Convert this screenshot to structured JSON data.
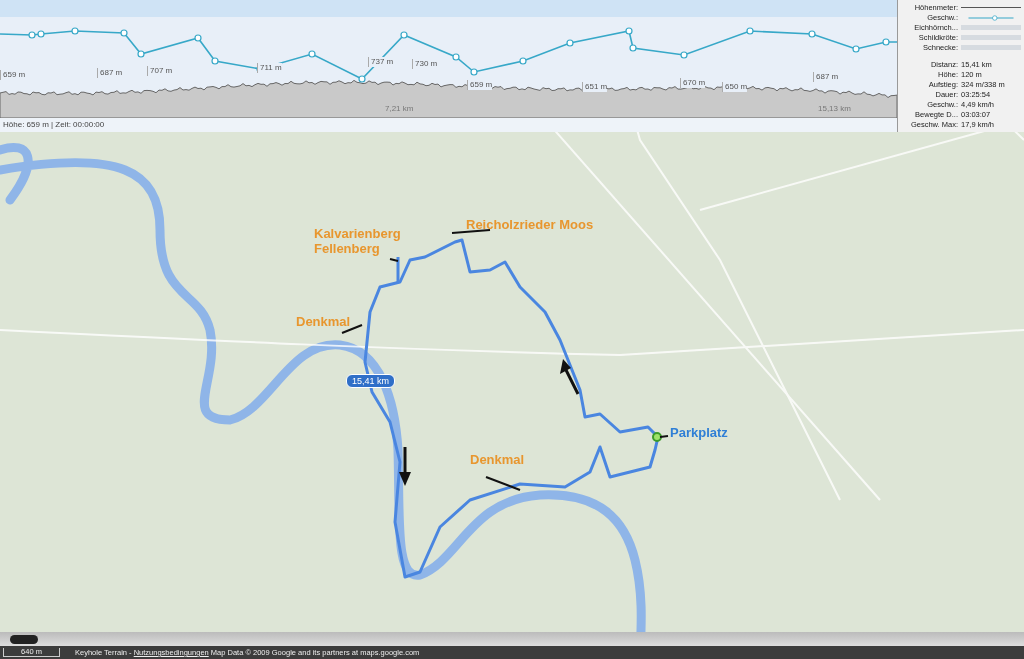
{
  "profile": {
    "elevation_labels": [
      "659 m",
      "687 m",
      "707 m",
      "711 m",
      "737 m",
      "730 m",
      "659 m",
      "651 m",
      "670 m",
      "650 m",
      "687 m"
    ],
    "distance_labels": [
      "7,21 km",
      "15,13 km"
    ],
    "status": "Höhe: 659 m | Zeit: 00:00:00"
  },
  "legend": [
    {
      "label": "Höhenmeter:",
      "kind": "elevation"
    },
    {
      "label": "Geschw.:",
      "kind": "speed"
    },
    {
      "label": "Eichhörnch...",
      "kind": "band"
    },
    {
      "label": "Schildkröte:",
      "kind": "band"
    },
    {
      "label": "Schnecke:",
      "kind": "band"
    }
  ],
  "stats": [
    {
      "label": "Distanz:",
      "value": "15,41 km"
    },
    {
      "label": "Höhe:",
      "value": "120 m"
    },
    {
      "label": "Aufstieg:",
      "value": "324 m/338 m"
    },
    {
      "label": "Dauer:",
      "value": "03:25:54"
    },
    {
      "label": "Geschw.:",
      "value": "4,49 km/h"
    },
    {
      "label": "Bewegte D...",
      "value": "03:03:07"
    },
    {
      "label": "Geschw. Max:",
      "value": "17,9 km/h"
    }
  ],
  "map": {
    "annotations": [
      {
        "text": "Kalvarienberg\nFellenberg",
        "kind": "orange"
      },
      {
        "text": "Reicholzrieder Moos",
        "kind": "orange"
      },
      {
        "text": "Denkmal",
        "kind": "orange"
      },
      {
        "text": "Denkmal",
        "kind": "orange"
      },
      {
        "text": "Parkplatz",
        "kind": "blue"
      }
    ],
    "distance_badge": "15,41 km"
  },
  "footer": {
    "scale": "640 m",
    "before": "Keyhole Terrain - ",
    "link": "Nutzungsbedingungen",
    "after": " Map Data © 2009 Google and its partners at maps.google.com"
  }
}
